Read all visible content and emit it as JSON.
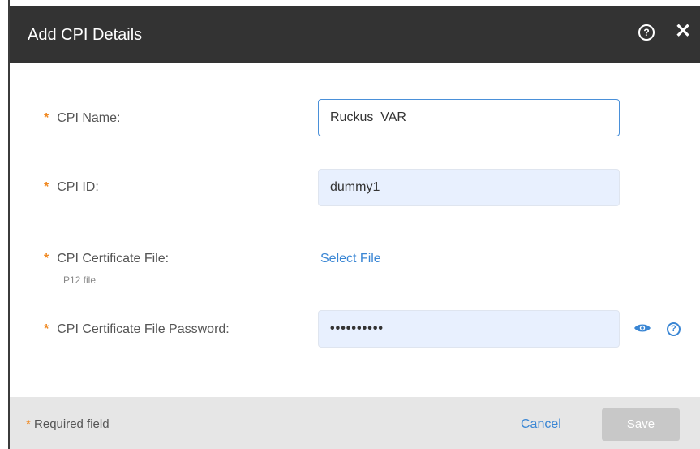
{
  "dialog": {
    "title": "Add CPI Details",
    "help_icon": "question-circle-icon",
    "close_icon": "close-icon"
  },
  "form": {
    "required_marker": "*",
    "cpi_name": {
      "label": "CPI Name:",
      "value": "Ruckus_VAR"
    },
    "cpi_id": {
      "label": "CPI ID:",
      "value": "dummy1"
    },
    "cert_file": {
      "label": "CPI Certificate File:",
      "sublabel": "P12 file",
      "action": "Select File"
    },
    "cert_password": {
      "label": "CPI Certificate File Password:",
      "value": "••••••••••"
    }
  },
  "footer": {
    "required_note": "Required field",
    "cancel_label": "Cancel",
    "save_label": "Save"
  },
  "colors": {
    "header_bg": "#333333",
    "accent": "#3a86d4",
    "required_star": "#f08a24",
    "footer_bg": "#e6e6e6",
    "save_disabled": "#c8c8c8"
  }
}
